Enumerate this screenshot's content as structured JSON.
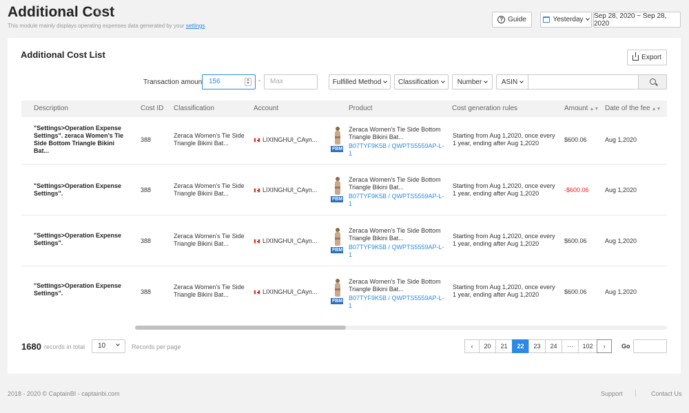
{
  "header": {
    "title": "Additional Cost",
    "info_icon": "info-icon",
    "subtitle_prefix": "This module mainly displays operating expenses data generated by your",
    "subtitle_link": "settings",
    "subtitle_suffix": ".",
    "guide_label": "Guide",
    "date_preset": "Yesterday",
    "date_range": "Sep 28, 2020 ~ Sep 28, 2020"
  },
  "panel": {
    "title": "Additional Cost List",
    "export_label": "Export"
  },
  "filters": {
    "transaction_label": "Transaction amount",
    "min_value": "156",
    "dash": "-",
    "max_placeholder": "Max",
    "fulfilled": "Fulfilled Method",
    "classification": "Classification",
    "number": "Number",
    "asin": "ASIN"
  },
  "table": {
    "columns": [
      "Description",
      "Cost ID",
      "Classification",
      "Account",
      "Product",
      "Cost generation rules",
      "Amount",
      "Date of the fee"
    ],
    "rows": [
      {
        "description": "\"Settings>Operation Expense Settings\". zeraca Women's Tie Side Bottom Triangle Bikini Bat...",
        "cost_id": "388",
        "classification": "Zeraca Women's Tie Side Triangle Bikini Bat...",
        "account": "LIXINGHUI_CAyn...",
        "badge": "FBM",
        "product": "Zeraca Women's Tie Side Bottom Triangle Bikini Bat...",
        "product_link": "B07TYF9K5B / QWPTS5559AP-L-1",
        "rule": "Starting from Aug 1,2020, once every 1 year, ending after Aug 1,2020",
        "amount": "$600.06",
        "date": "Aug 1,2020"
      },
      {
        "description": "\"Settings>Operation Expense Settings\".",
        "cost_id": "388",
        "classification": "Zeraca Women's Tie Side Triangle Bikini Bat...",
        "account": "LIXINGHUI_CAyn...",
        "badge": "FBM",
        "product": "Zeraca Women's Tie Side Bottom Triangle Bikini Bat...",
        "product_link": "B07TYF9K5B / QWPTS5559AP-L-1",
        "rule": "Starting from Aug 1,2020, once every 1 year, ending after Aug 1,2020",
        "amount": "-$600.06",
        "date": "Aug 1,2020"
      },
      {
        "description": "\"Settings>Operation Expense Settings\".",
        "cost_id": "388",
        "classification": "Zeraca Women's Tie Side Triangle Bikini Bat...",
        "account": "LIXINGHUI_CAyn...",
        "badge": "FBM",
        "product": "Zeraca Women's Tie Side Bottom Triangle Bikini Bat...",
        "product_link": "B07TYF9K5B / QWPTS5559AP-L-1",
        "rule": "Starting from Aug 1,2020, once every 1 year, ending after Aug 1,2020",
        "amount": "$600.06",
        "date": "Aug 1,2020"
      },
      {
        "description": "\"Settings>Operation Expense Settings\".",
        "cost_id": "388",
        "classification": "Zeraca Women's Tie Side Triangle Bikini Bat...",
        "account": "LIXINGHUI_CAyn...",
        "badge": "FBM",
        "product": "Zeraca Women's Tie Side Bottom Triangle Bikini Bat...",
        "product_link": "B07TYF9K5B / QWPTS5559AP-L-1",
        "rule": "Starting from Aug 1,2020, once every 1 year, ending after Aug 1,2020",
        "amount": "$600.06",
        "date": "Aug 1,2020"
      }
    ]
  },
  "pagination": {
    "total": "1680",
    "total_label": "records in total",
    "page_size": "10",
    "per_page_label": "Records per page",
    "prev": "‹",
    "pages": [
      "20",
      "21",
      "22",
      "23",
      "24",
      "···",
      "102"
    ],
    "current": "22",
    "next": "›",
    "go_label": "Go"
  },
  "footer": {
    "copyright": "2018 - 2020 © CaptainBI - captainbi.com",
    "support": "Support",
    "contact": "Contact Us"
  },
  "colors": {
    "accent": "#2a8ae6",
    "negative": "#e02020",
    "badge": "#2a6ebf"
  }
}
